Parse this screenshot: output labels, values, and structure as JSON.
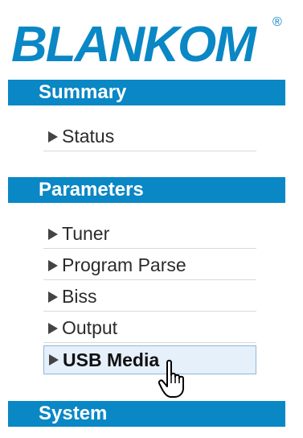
{
  "logo": {
    "text": "BLANKOM",
    "registered": "®"
  },
  "sections": {
    "summary": {
      "title": "Summary",
      "items": [
        "Status"
      ]
    },
    "parameters": {
      "title": "Parameters",
      "items": [
        "Tuner",
        "Program Parse",
        "Biss",
        "Output",
        "USB Media"
      ]
    },
    "system": {
      "title": "System"
    }
  },
  "active_item": "USB Media",
  "colors": {
    "header_bg": "#0a87c5",
    "logo": "#0a87c5",
    "active_bg": "#e5f0fb"
  },
  "icons": {
    "menu_arrow": "triangle-right-icon",
    "cursor": "hand-pointer-icon"
  }
}
